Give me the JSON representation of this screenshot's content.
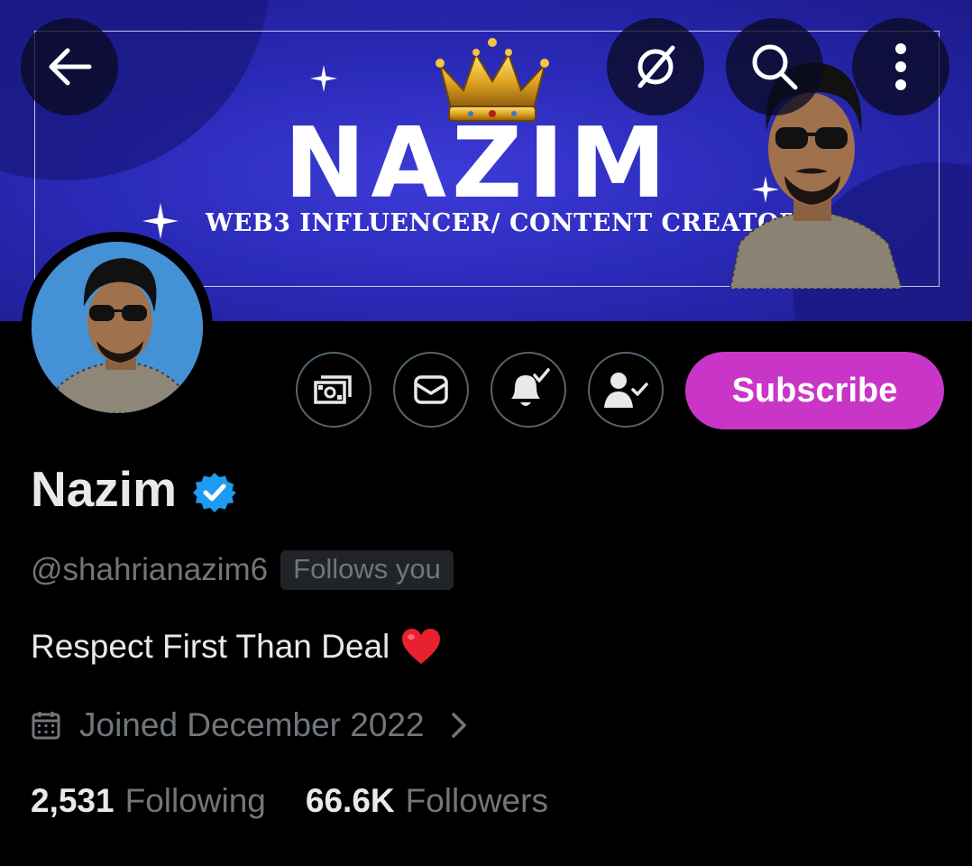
{
  "banner": {
    "title": "NAZIM",
    "subtitle": "WEB3 INFLUENCER/ CONTENT CREATOR"
  },
  "header": {
    "icons": [
      "back-arrow-icon",
      "grok-icon",
      "search-icon",
      "more-vertical-icon"
    ]
  },
  "actions": {
    "icons": [
      "tip-money-icon",
      "message-icon",
      "notification-bell-check-icon",
      "following-user-check-icon"
    ],
    "subscribe_label": "Subscribe"
  },
  "profile": {
    "name": "Nazim",
    "verified": true,
    "handle": "@shahrianazim6",
    "follows_you": "Follows you",
    "bio": "Respect First Than Deal",
    "bio_emoji": "red-heart",
    "joined": "Joined December 2022",
    "following_count": "2,531",
    "following_label": "Following",
    "followers_count": "66.6K",
    "followers_label": "Followers"
  },
  "colors": {
    "background": "#000000",
    "banner_blue": "#2a2ab8",
    "subscribe": "#c936c7",
    "verified": "#1d9bf0",
    "muted_text": "#71767b",
    "primary_text": "#e7e9ea"
  }
}
